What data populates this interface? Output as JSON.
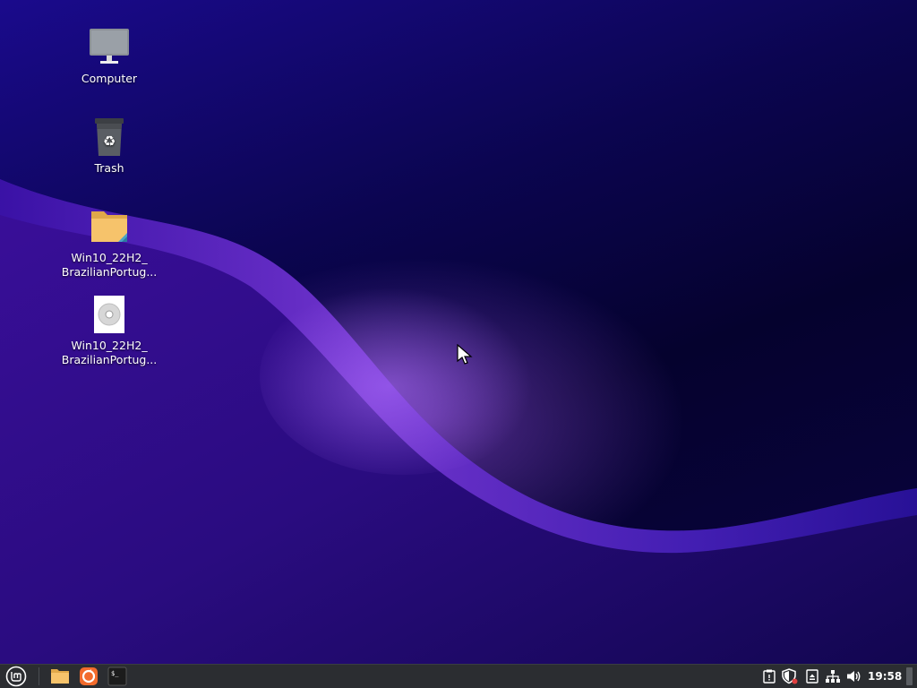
{
  "desktop": {
    "icons": [
      {
        "label": "Computer",
        "icon": "computer-icon"
      },
      {
        "label": "Trash",
        "icon": "trash-icon"
      },
      {
        "label_line1": "Win10_22H2_",
        "label_line2": "BrazilianPortug...",
        "icon": "folder-icon"
      },
      {
        "label_line1": "Win10_22H2_",
        "label_line2": "BrazilianPortug...",
        "icon": "disc-image-icon"
      }
    ]
  },
  "taskbar": {
    "menu_icon": "linux-mint-menu-icon",
    "launchers": [
      "files-icon",
      "firefox-icon",
      "terminal-icon"
    ],
    "terminal_glyph": "$_",
    "tray": [
      "clipboard-icon",
      "update-manager-shield-icon",
      "removable-drive-icon",
      "network-icon",
      "volume-icon"
    ],
    "clock": "19:58"
  },
  "colors": {
    "taskbar_bg": "#2b2d31",
    "folder": "#f6c36b",
    "firefox_orange": "#f26b2c"
  }
}
